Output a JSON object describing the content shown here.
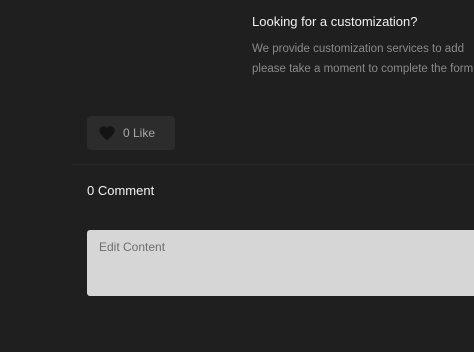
{
  "customization": {
    "title": "Looking for a customization?",
    "line1": "We provide customization services to add",
    "line2": "please take a moment to complete the form"
  },
  "like": {
    "label": "0 Like",
    "icon": "heart-icon"
  },
  "comments": {
    "count_label": "0 Comment",
    "editor_placeholder": "Edit Content"
  },
  "colors": {
    "background": "#1f1f1f",
    "like_button_bg": "#2c2c2c",
    "editor_bg": "#d6d6d6"
  }
}
